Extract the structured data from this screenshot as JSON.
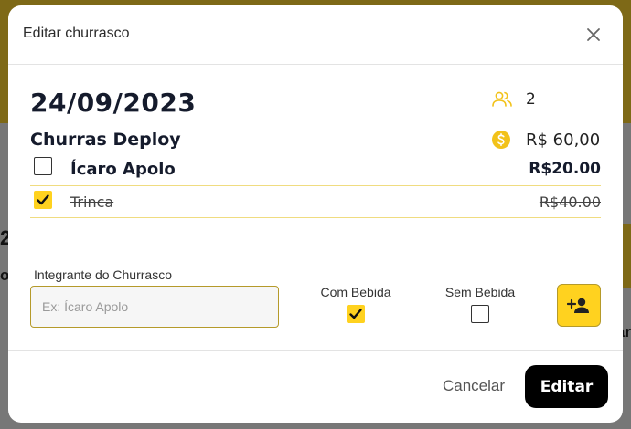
{
  "background": {
    "fragment_left_1": "2",
    "fragment_left_2": "o",
    "fragment_right_1": "ar"
  },
  "modal": {
    "title": "Editar churrasco",
    "close_icon": "close-icon"
  },
  "event": {
    "date": "24/09/2023",
    "name": "Churras Deploy",
    "people_count": "2",
    "total": "R$ 60,00"
  },
  "participants": [
    {
      "name": "Ícaro Apolo",
      "amount": "R$20.00",
      "paid": false
    },
    {
      "name": "Trinca",
      "amount": "R$40.00",
      "paid": true
    }
  ],
  "form": {
    "label": "Integrante do Churrasco",
    "placeholder": "Ex: Ícaro Apolo",
    "value": "",
    "with_drink_label": "Com Bebida",
    "with_drink_checked": true,
    "without_drink_label": "Sem Bebida",
    "without_drink_checked": false,
    "add_icon": "person-add-icon"
  },
  "footer": {
    "cancel_label": "Cancelar",
    "edit_label": "Editar"
  },
  "colors": {
    "accent": "#FFD21F",
    "accent_border": "#B59A2A",
    "dark_text": "#151B2C"
  }
}
